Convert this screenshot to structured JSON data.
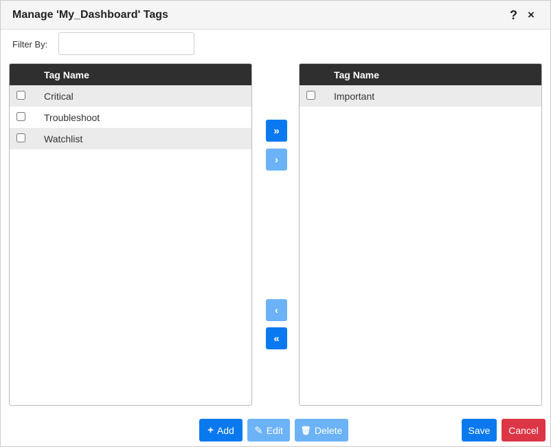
{
  "dialog": {
    "title": "Manage 'My_Dashboard' Tags",
    "help_icon": "?",
    "close_icon": "×"
  },
  "filter": {
    "label": "Filter By:",
    "value": "",
    "placeholder": ""
  },
  "available": {
    "header": "Tag Name",
    "items": [
      {
        "label": "Critical"
      },
      {
        "label": "Troubleshoot"
      },
      {
        "label": "Watchlist"
      }
    ]
  },
  "assigned": {
    "header": "Tag Name",
    "items": [
      {
        "label": "Important"
      }
    ]
  },
  "move_buttons": {
    "add_all": "»",
    "add_selected": "›",
    "remove_selected": "‹",
    "remove_all": "«"
  },
  "footer": {
    "add_label": "Add",
    "add_icon": "+",
    "edit_label": "Edit",
    "edit_icon": "✎",
    "delete_label": "Delete",
    "delete_icon": "🗑",
    "save_label": "Save",
    "cancel_label": "Cancel"
  },
  "colors": {
    "primary": "#0a79ef",
    "disabled": "#6cb2f7",
    "danger": "#dc3545",
    "header": "#2f2f2f"
  }
}
